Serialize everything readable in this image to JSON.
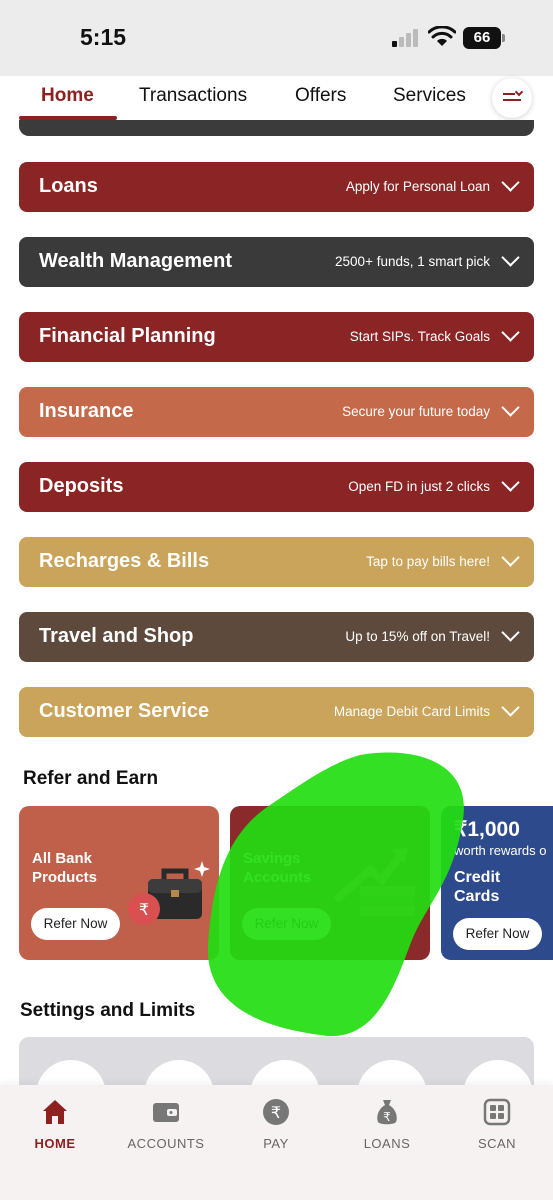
{
  "status_bar": {
    "time": "5:15",
    "battery": "66"
  },
  "tabs": [
    {
      "label": "Home",
      "active": true
    },
    {
      "label": "Transactions",
      "active": false
    },
    {
      "label": "Offers",
      "active": false
    },
    {
      "label": "Services",
      "active": false
    }
  ],
  "categories": [
    {
      "title": "Loans",
      "subtitle": "Apply for Personal Loan",
      "color": "#8b2525"
    },
    {
      "title": "Wealth Management",
      "subtitle": "2500+ funds, 1 smart pick",
      "color": "#3a3a3a"
    },
    {
      "title": "Financial Planning",
      "subtitle": "Start SIPs. Track Goals",
      "color": "#8b2525"
    },
    {
      "title": "Insurance",
      "subtitle": "Secure your future today",
      "color": "#c4694a"
    },
    {
      "title": "Deposits",
      "subtitle": "Open FD in just 2 clicks",
      "color": "#8b2525"
    },
    {
      "title": "Recharges & Bills",
      "subtitle": "Tap to pay bills here!",
      "color": "#c9a45a"
    },
    {
      "title": "Travel and Shop",
      "subtitle": "Up to 15% off on Travel!",
      "color": "#5e4a3c"
    },
    {
      "title": "Customer Service",
      "subtitle": "Manage Debit Card Limits",
      "color": "#c9a45a"
    }
  ],
  "refer": {
    "title": "Refer and Earn",
    "cards": [
      {
        "label_line1": "All Bank",
        "label_line2": "Products",
        "button": "Refer Now",
        "color": "#c0604a",
        "icon": "briefcase-icon"
      },
      {
        "label_line1": "Savings",
        "label_line2": "Accounts",
        "button": "Refer Now",
        "color": "#8a2a2a",
        "icon": "money-growth-icon"
      },
      {
        "amount": "₹1,000",
        "amount_sub": "worth rewards o",
        "label_line1": "Credit",
        "label_line2": "Cards",
        "button": "Refer Now",
        "color": "#2d4a8c"
      }
    ]
  },
  "settings": {
    "title": "Settings and Limits"
  },
  "bottom_nav": [
    {
      "label": "HOME",
      "icon": "home-icon",
      "active": true
    },
    {
      "label": "ACCOUNTS",
      "icon": "wallet-icon",
      "active": false
    },
    {
      "label": "PAY",
      "icon": "rupee-icon",
      "active": false
    },
    {
      "label": "LOANS",
      "icon": "money-bag-icon",
      "active": false
    },
    {
      "label": "SCAN",
      "icon": "scan-icon",
      "active": false
    }
  ],
  "colors": {
    "brand": "#8e2020",
    "highlight": "#22dd11"
  }
}
